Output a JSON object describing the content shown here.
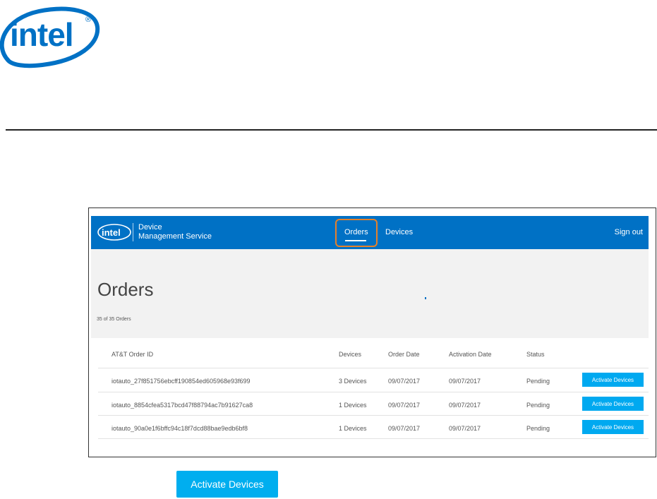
{
  "logo": {
    "text": "intel",
    "registered": "®"
  },
  "embedded": {
    "nav": {
      "logo_text": "intel",
      "app_title_line1": "Device",
      "app_title_line2": "Management Service",
      "links": [
        "Orders",
        "Devices"
      ],
      "active": "Orders",
      "sign_out": "Sign out",
      "highlight_color": "#e6812a",
      "bg_color": "#0071c5"
    },
    "page": {
      "title": "Orders",
      "count_text": "35 of 35 Orders"
    },
    "table": {
      "headers": [
        "AT&T Order ID",
        "Devices",
        "Order Date",
        "Activation Date",
        "Status"
      ],
      "rows": [
        {
          "id": "iotauto_27f851756ebcff190854ed605968e93f699",
          "devices": "3 Devices",
          "order_date": "09/07/2017",
          "activation_date": "09/07/2017",
          "status": "Pending",
          "action": "Activate Devices"
        },
        {
          "id": "iotauto_8854cfea5317bcd47f88794ac7b91627ca8",
          "devices": "1 Devices",
          "order_date": "09/07/2017",
          "activation_date": "09/07/2017",
          "status": "Pending",
          "action": "Activate Devices"
        },
        {
          "id": "iotauto_90a0e1f6bffc94c18f7dcd88bae9edb6bf8",
          "devices": "1 Devices",
          "order_date": "09/07/2017",
          "activation_date": "09/07/2017",
          "status": "Pending",
          "action": "Activate Devices"
        }
      ],
      "button_color": "#00a9f0"
    }
  },
  "activate_button": {
    "label": "Activate Devices",
    "color": "#00aeef"
  }
}
